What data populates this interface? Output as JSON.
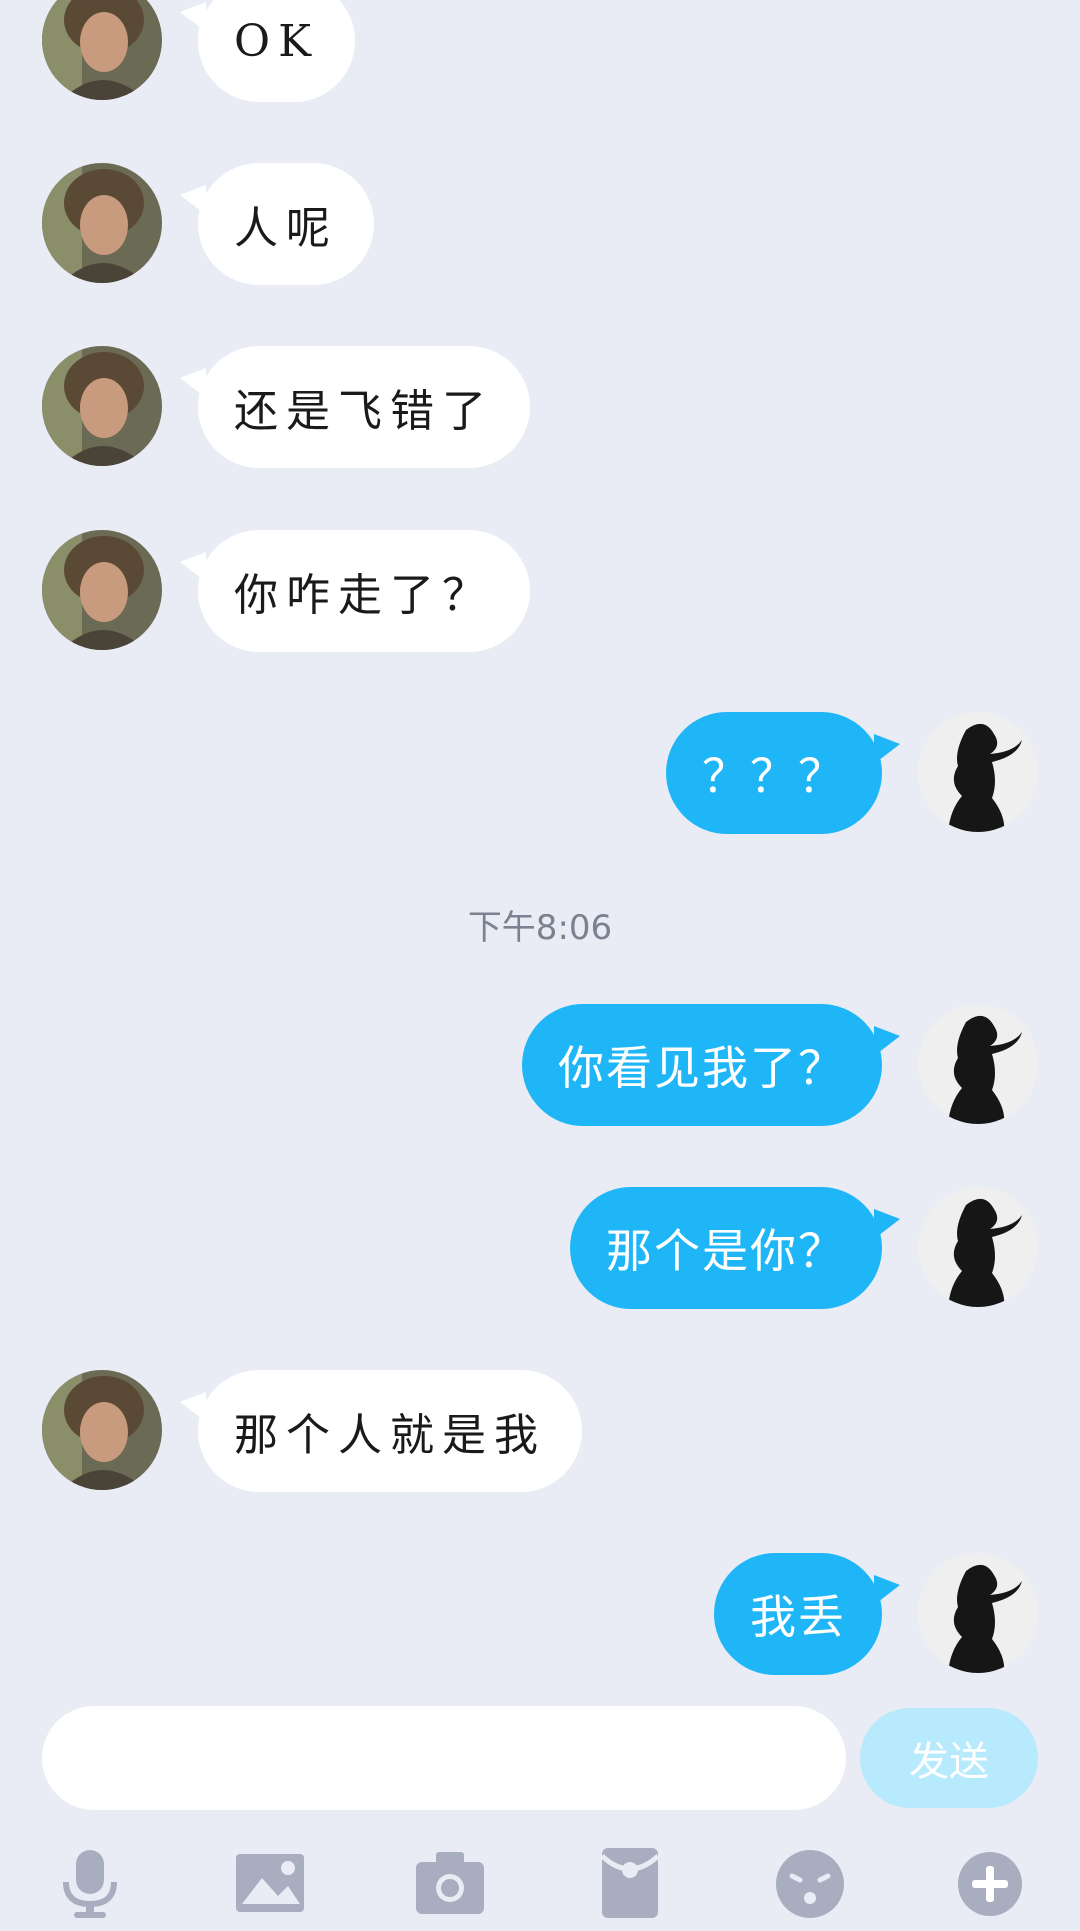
{
  "conversation": {
    "messages": [
      {
        "side": "in",
        "text": "OK"
      },
      {
        "side": "in",
        "text": "人呢"
      },
      {
        "side": "in",
        "text": "还是飞错了"
      },
      {
        "side": "in",
        "text": "你咋走了？"
      },
      {
        "side": "out",
        "text": "？？？"
      },
      {
        "side": "out",
        "text": "你看见我了？"
      },
      {
        "side": "out",
        "text": "那个是你？"
      },
      {
        "side": "in",
        "text": "那个人就是我"
      },
      {
        "side": "out",
        "text": "我丢"
      }
    ],
    "timestamp": "下午8:06"
  },
  "input": {
    "value": "",
    "placeholder": ""
  },
  "send": {
    "label": "发送"
  },
  "toolbar": {
    "icons": [
      "microphone-icon",
      "image-icon",
      "camera-icon",
      "red-packet-icon",
      "emoji-icon",
      "plus-icon"
    ]
  },
  "colors": {
    "background": "#e9ecf4",
    "incoming_bubble": "#ffffff",
    "outgoing_bubble": "#1fb6f7",
    "send_button": "#b7eafd",
    "toolbar_icon": "#a8aec0"
  }
}
